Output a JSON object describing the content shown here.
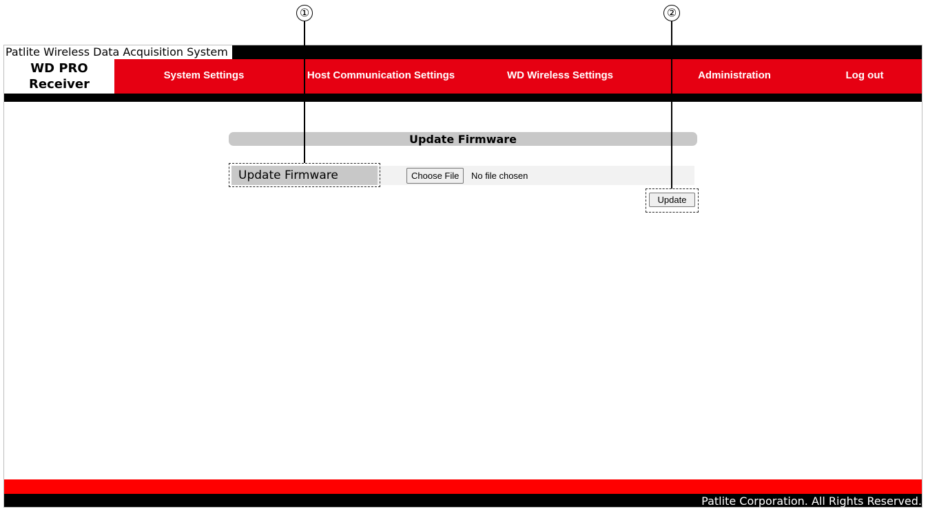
{
  "header": {
    "system_title": "Patlite Wireless Data Acquisition System",
    "brand_line1": "WD PRO",
    "brand_line2": "Receiver"
  },
  "nav": {
    "items": [
      {
        "label": "System Settings"
      },
      {
        "label": "Host Communication Settings"
      },
      {
        "label": "WD Wireless Settings"
      },
      {
        "label": "Administration"
      },
      {
        "label": "Log out"
      }
    ]
  },
  "main": {
    "section_title": "Update Firmware",
    "field_label": "Update Firmware",
    "file_button_label": "Choose File",
    "file_status": "No file chosen",
    "update_button_label": "Update"
  },
  "callouts": [
    "①",
    "②"
  ],
  "footer": {
    "copyright": "Patlite Corporation. All Rights Reserved."
  },
  "colors": {
    "nav_red": "#e60012",
    "footer_red": "#ff0000",
    "bar_black": "#000000",
    "section_gray": "#c8c8c8"
  }
}
